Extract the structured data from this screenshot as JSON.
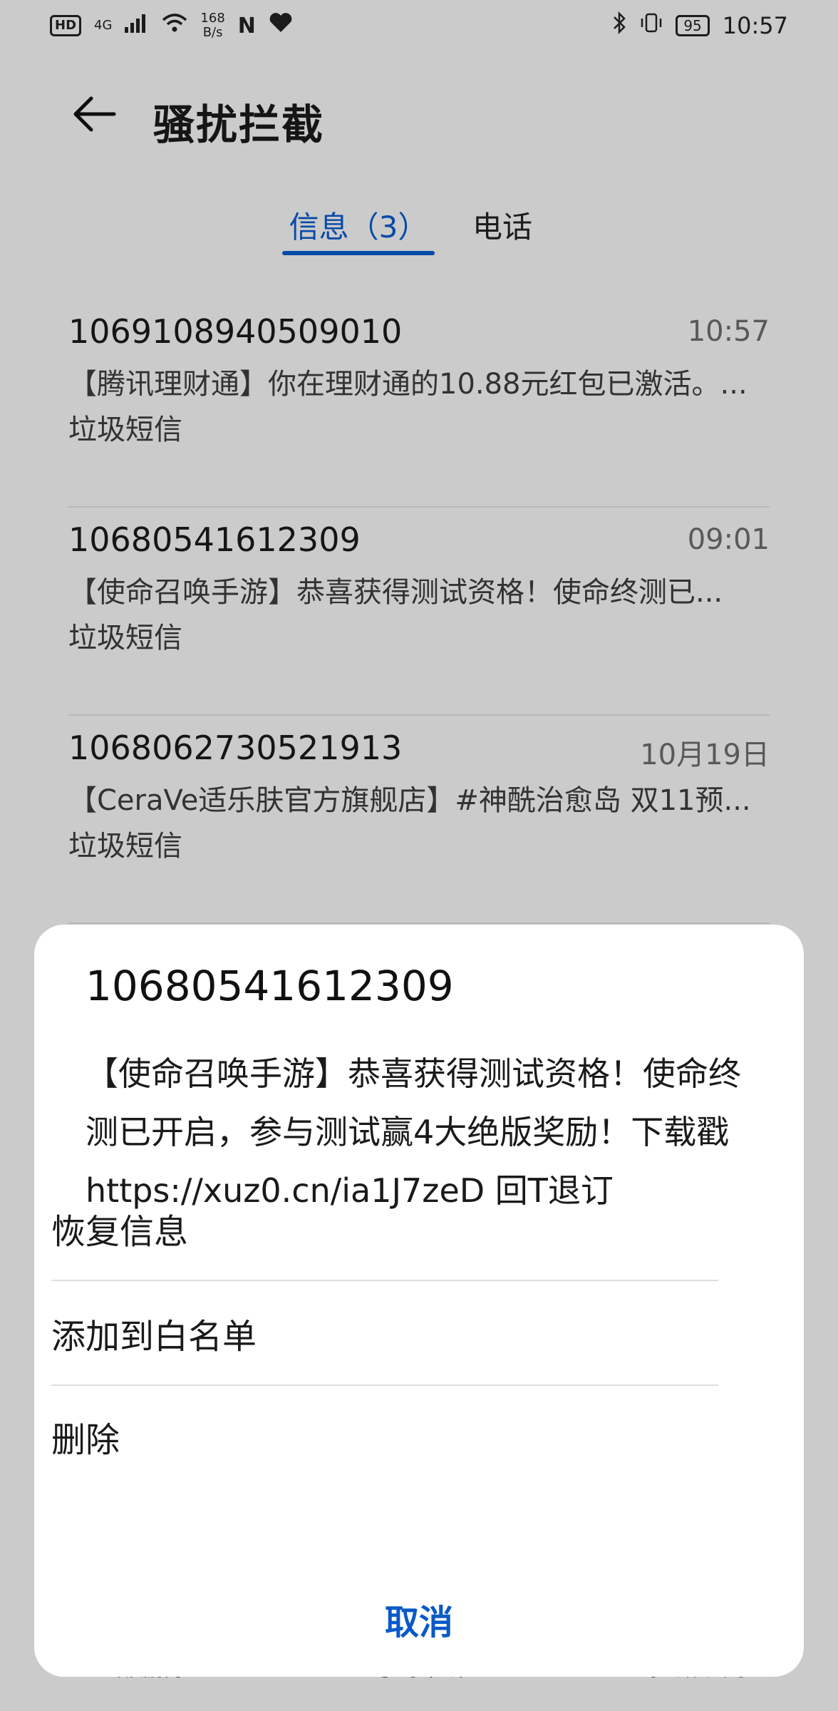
{
  "status_bar": {
    "hd": "HD",
    "network": "4G",
    "speed_value": "168",
    "speed_unit": "B/s",
    "nfc": "N",
    "battery": "95",
    "time": "10:57"
  },
  "header": {
    "title": "骚扰拦截"
  },
  "tabs": [
    {
      "label": "信息（3）",
      "selected": true
    },
    {
      "label": "电话",
      "selected": false
    }
  ],
  "messages": [
    {
      "number": "1069108940509010",
      "time": "10:57",
      "preview": "【腾讯理财通】你在理财通的10.88元红包已激活。...",
      "tag": "垃圾短信"
    },
    {
      "number": "10680541612309",
      "time": "09:01",
      "preview": "【使命召唤手游】恭喜获得测试资格！使命终测已...",
      "tag": "垃圾短信"
    },
    {
      "number": "1068062730521913",
      "time": "10月19日",
      "preview": "【CeraVe适乐肤官方旗舰店】#神酰治愈岛 双11预...",
      "tag": "垃圾短信"
    }
  ],
  "bottom_bar": [
    "全部删除",
    "号码申诉",
    "拦截规则"
  ],
  "sheet": {
    "number": "10680541612309",
    "body": "【使命召唤手游】恭喜获得测试资格！使命终测已开启，参与测试赢4大绝版奖励！下载戳 https://xuz0.cn/ia1J7zeD 回T退订",
    "actions": [
      "恢复信息",
      "添加到白名单",
      "删除"
    ],
    "cancel": "取消"
  },
  "colors": {
    "accent": "#0a59c9",
    "overlay": "rgba(0,0,0,0.17)"
  }
}
